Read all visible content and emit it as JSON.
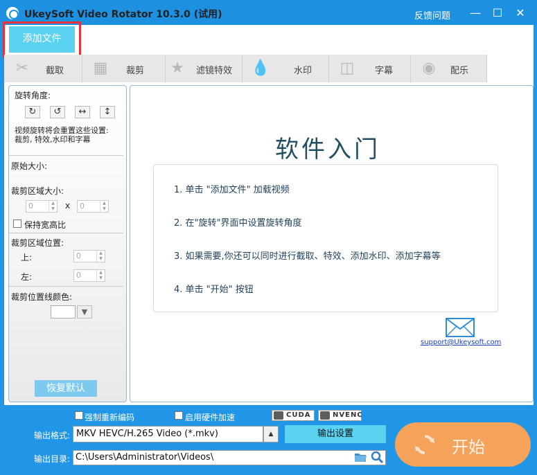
{
  "window": {
    "title": "UkeySoft Video Rotator 10.3.0 (试用)",
    "feedback": "反馈问题",
    "min_icon": "minimize-icon",
    "max_icon": "maximize-icon",
    "close_icon": "close-icon"
  },
  "toolbar": {
    "add_file": "添加文件"
  },
  "tabs": [
    {
      "label": "截取",
      "icon": "trim-icon"
    },
    {
      "label": "裁剪",
      "icon": "crop-icon"
    },
    {
      "label": "滤镜特效",
      "icon": "effects-icon"
    },
    {
      "label": "水印",
      "icon": "watermark-icon"
    },
    {
      "label": "字幕",
      "icon": "subtitle-icon"
    },
    {
      "label": "配乐",
      "icon": "music-icon"
    }
  ],
  "left": {
    "rotation_label": "旋转角度:",
    "rotation_note_1": "视频旋转将会重置这些设置:",
    "rotation_note_2": "裁剪, 特效,水印和字幕",
    "original_size_label": "原始大小:",
    "crop_size_label": "裁剪区域大小:",
    "crop_width": "0",
    "crop_x": "x",
    "crop_height": "0",
    "keep_ratio_label": "保持宽高比",
    "crop_position_label": "裁剪区域位置:",
    "top_label": "上:",
    "top_value": "0",
    "left_label": "左:",
    "left_value": "0",
    "line_color_label": "裁剪位置线颜色:",
    "reset_label": "恢复默认"
  },
  "intro": {
    "title": "软件入门",
    "steps": [
      "1. 单击 \"添加文件\" 加载视频",
      "2. 在\"旋转\"界面中设置旋转角度",
      "3. 如果需要,你还可以同时进行截取、特效、添加水印、添加字幕等",
      "4. 单击 \"开始\" 按钮"
    ],
    "support": "support@Ukeysoft.com"
  },
  "bottom": {
    "force_reencode": "强制重新编码",
    "hw_accel": "启用硬件加速",
    "cuda": "CUDA",
    "nvenc": "NVENC",
    "format_label": "输出格式:",
    "format_value": "MKV HEVC/H.265 Video (*.mkv)",
    "output_settings": "输出设置",
    "dir_label": "输出目录:",
    "dir_value": "C:\\Users\\Administrator\\Videos\\",
    "start": "开始"
  }
}
